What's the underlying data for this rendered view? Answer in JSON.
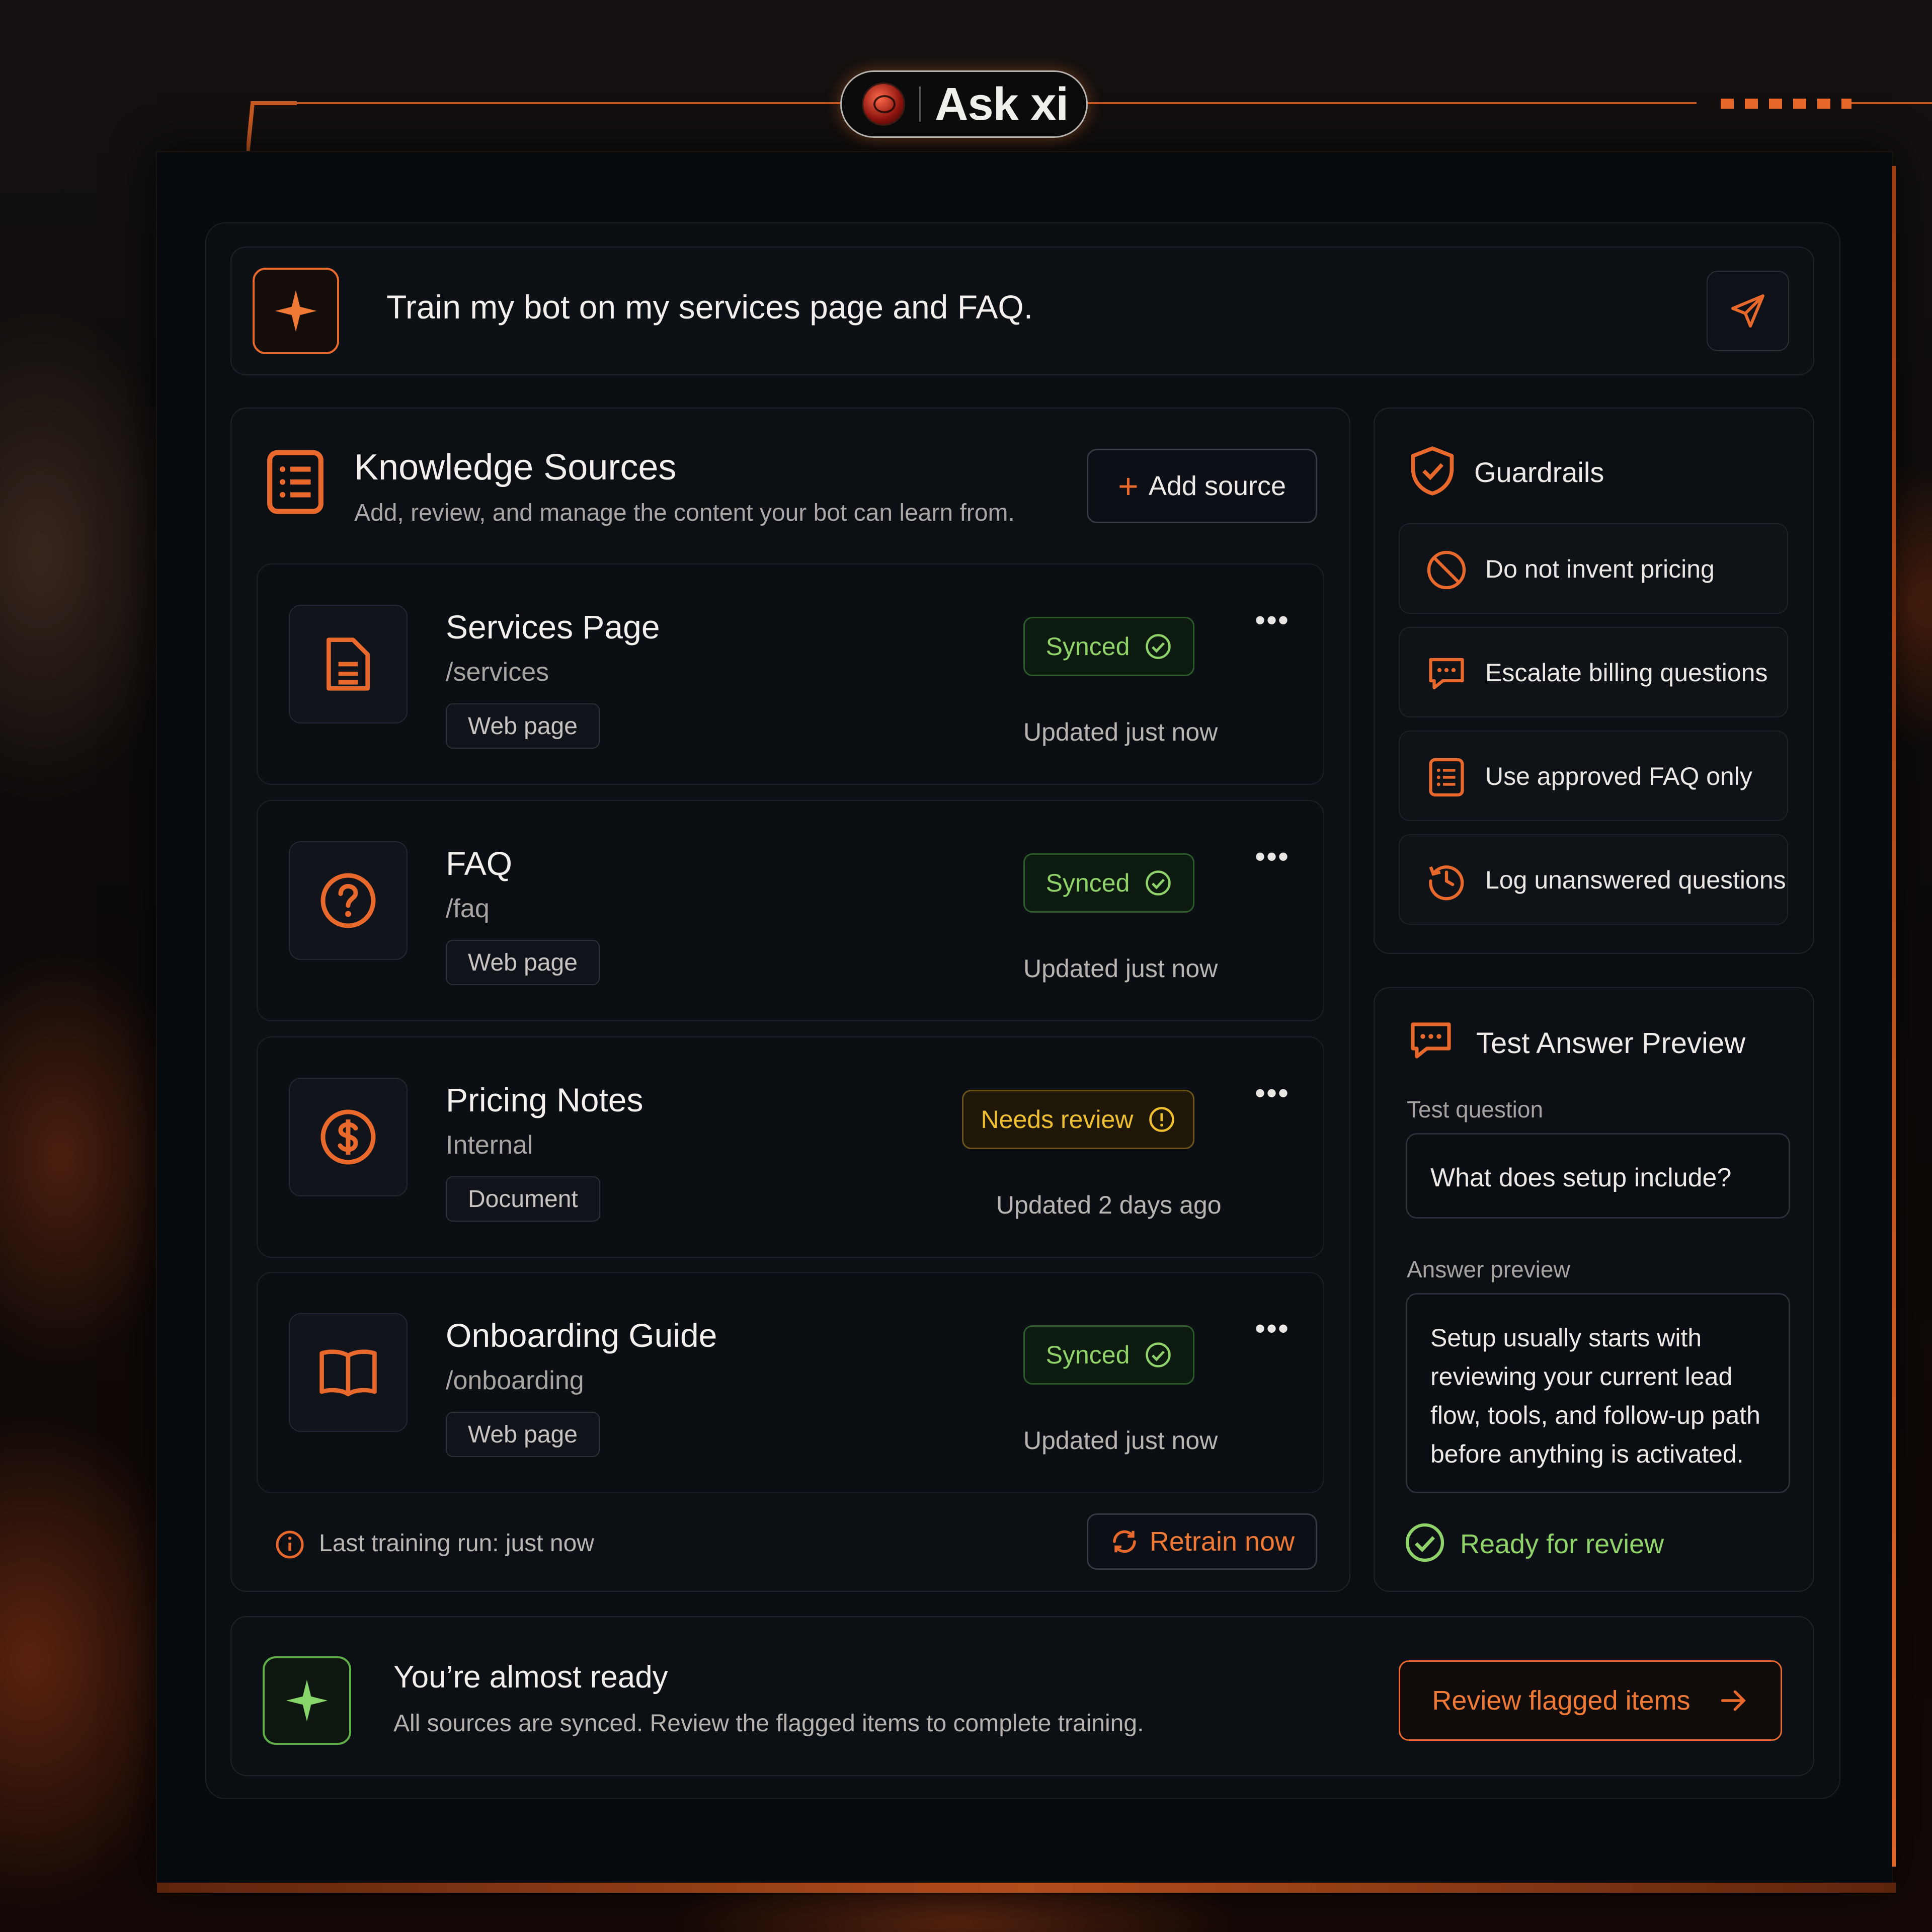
{
  "app": {
    "logo_text": "Ask xi"
  },
  "prompt": {
    "text": "Train my bot on my services page and FAQ."
  },
  "knowledge": {
    "title": "Knowledge Sources",
    "subtitle": "Add, review, and manage the content your bot can learn from.",
    "add_label": "Add source",
    "sources": [
      {
        "name": "Services Page",
        "path": "/services",
        "type": "Web page",
        "status": "Synced",
        "updated": "Updated just now",
        "icon": "document-icon"
      },
      {
        "name": "FAQ",
        "path": "/faq",
        "type": "Web page",
        "status": "Synced",
        "updated": "Updated just now",
        "icon": "question-icon"
      },
      {
        "name": "Pricing Notes",
        "path": "Internal",
        "type": "Document",
        "status": "Needs review",
        "updated": "Updated 2 days ago",
        "icon": "dollar-icon"
      },
      {
        "name": "Onboarding Guide",
        "path": "/onboarding",
        "type": "Web page",
        "status": "Synced",
        "updated": "Updated just now",
        "icon": "book-icon"
      }
    ],
    "footer_text": "Last training run: just now",
    "retrain_label": "Retrain now"
  },
  "guardrails": {
    "title": "Guardrails",
    "items": [
      {
        "label": "Do not invent pricing",
        "icon": "prohibited-icon"
      },
      {
        "label": "Escalate billing questions",
        "icon": "chat-icon"
      },
      {
        "label": "Use approved FAQ only",
        "icon": "list-icon"
      },
      {
        "label": "Log unanswered questions",
        "icon": "history-icon"
      }
    ]
  },
  "preview": {
    "title": "Test Answer Preview",
    "question_label": "Test question",
    "question": "What does setup include?",
    "answer_label": "Answer preview",
    "answer_lines": [
      "Setup usually starts with",
      "reviewing your current lead",
      "flow, tools, and follow-up path",
      "before anything is activated."
    ],
    "status": "Ready for review"
  },
  "banner": {
    "title": "You’re almost ready",
    "subtitle": "All sources are synced. Review the flagged items to complete training.",
    "cta_label": "Review flagged items"
  },
  "colors": {
    "accent": "#e8692b",
    "success": "#8fd36a",
    "warning": "#f0c030",
    "background": "#070a0f"
  }
}
